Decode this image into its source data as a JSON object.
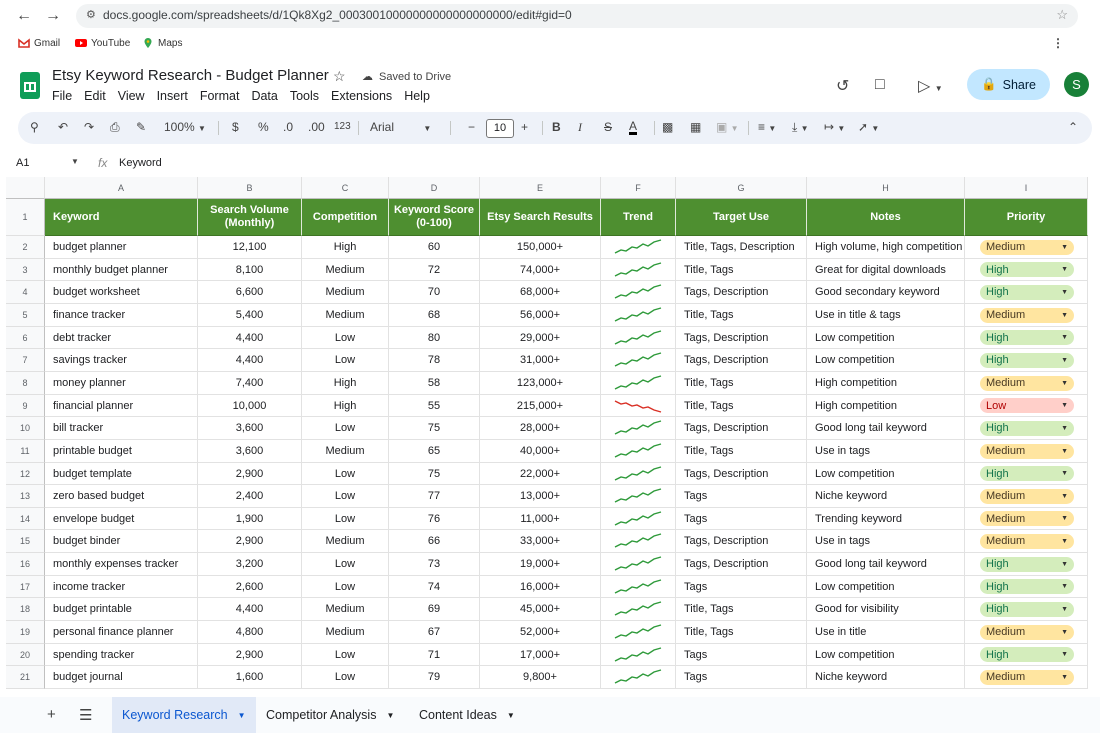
{
  "browser": {
    "url": "docs.google.com/spreadsheets/d/1Qk8Xg2_00030010000000000000000000/edit#gid=0",
    "bookmarks": [
      "Gmail",
      "YouTube",
      "Maps"
    ]
  },
  "doc": {
    "title": "Etsy Keyword Research - Budget Planner",
    "saved_status": "Saved to Drive",
    "menu": [
      "File",
      "Edit",
      "View",
      "Insert",
      "Format",
      "Data",
      "Tools",
      "Extensions",
      "Help"
    ],
    "share_label": "Share",
    "avatar_initial": "S"
  },
  "toolbar": {
    "zoom": "100%",
    "currency": "$",
    "percent": "%",
    "dec_decrease": ".0",
    "dec_increase": ".00",
    "number_format": "123",
    "font": "Arial",
    "font_size": "10",
    "bold": "B",
    "italic": "I",
    "strike": "S",
    "text_color": "A"
  },
  "formula_bar": {
    "cell_ref": "A1",
    "fx": "fx",
    "value": "Keyword"
  },
  "sheet": {
    "col_letters": [
      "A",
      "B",
      "C",
      "D",
      "E",
      "F",
      "G",
      "H",
      "I"
    ],
    "headers": [
      "Keyword",
      "Search Volume (Monthly)",
      "Competition",
      "Keyword Score (0-100)",
      "Etsy Search Results",
      "Trend",
      "Target Use",
      "Notes",
      "Priority"
    ],
    "rows": [
      {
        "n": "2",
        "keyword": "budget planner",
        "volume": "12,100",
        "competition": "High",
        "score": "60",
        "results": "150,000+",
        "trend": "up",
        "target": "Title, Tags, Description",
        "notes": "High volume, high competition",
        "priority": "Medium"
      },
      {
        "n": "3",
        "keyword": "monthly budget planner",
        "volume": "8,100",
        "competition": "Medium",
        "score": "72",
        "results": "74,000+",
        "trend": "up",
        "target": "Title, Tags",
        "notes": "Great for digital downloads",
        "priority": "High"
      },
      {
        "n": "4",
        "keyword": "budget worksheet",
        "volume": "6,600",
        "competition": "Medium",
        "score": "70",
        "results": "68,000+",
        "trend": "up",
        "target": "Tags, Description",
        "notes": "Good secondary keyword",
        "priority": "High"
      },
      {
        "n": "5",
        "keyword": "finance tracker",
        "volume": "5,400",
        "competition": "Medium",
        "score": "68",
        "results": "56,000+",
        "trend": "up",
        "target": "Title, Tags",
        "notes": "Use in title & tags",
        "priority": "Medium"
      },
      {
        "n": "6",
        "keyword": "debt tracker",
        "volume": "4,400",
        "competition": "Low",
        "score": "80",
        "results": "29,000+",
        "trend": "up",
        "target": "Tags, Description",
        "notes": "Low competition",
        "priority": "High"
      },
      {
        "n": "7",
        "keyword": "savings tracker",
        "volume": "4,400",
        "competition": "Low",
        "score": "78",
        "results": "31,000+",
        "trend": "up",
        "target": "Tags, Description",
        "notes": "Low competition",
        "priority": "High"
      },
      {
        "n": "8",
        "keyword": "money planner",
        "volume": "7,400",
        "competition": "High",
        "score": "58",
        "results": "123,000+",
        "trend": "up",
        "target": "Title, Tags",
        "notes": "High competition",
        "priority": "Medium"
      },
      {
        "n": "9",
        "keyword": "financial planner",
        "volume": "10,000",
        "competition": "High",
        "score": "55",
        "results": "215,000+",
        "trend": "down",
        "target": "Title, Tags",
        "notes": "High competition",
        "priority": "Low"
      },
      {
        "n": "10",
        "keyword": "bill tracker",
        "volume": "3,600",
        "competition": "Low",
        "score": "75",
        "results": "28,000+",
        "trend": "up",
        "target": "Tags, Description",
        "notes": "Good long tail keyword",
        "priority": "High"
      },
      {
        "n": "11",
        "keyword": "printable budget",
        "volume": "3,600",
        "competition": "Medium",
        "score": "65",
        "results": "40,000+",
        "trend": "up",
        "target": "Title, Tags",
        "notes": "Use in tags",
        "priority": "Medium"
      },
      {
        "n": "12",
        "keyword": "budget template",
        "volume": "2,900",
        "competition": "Low",
        "score": "75",
        "results": "22,000+",
        "trend": "up",
        "target": "Tags, Description",
        "notes": "Low competition",
        "priority": "High"
      },
      {
        "n": "13",
        "keyword": "zero based budget",
        "volume": "2,400",
        "competition": "Low",
        "score": "77",
        "results": "13,000+",
        "trend": "up",
        "target": "Tags",
        "notes": "Niche keyword",
        "priority": "Medium"
      },
      {
        "n": "14",
        "keyword": "envelope budget",
        "volume": "1,900",
        "competition": "Low",
        "score": "76",
        "results": "11,000+",
        "trend": "up",
        "target": "Tags",
        "notes": "Trending keyword",
        "priority": "Medium"
      },
      {
        "n": "15",
        "keyword": "budget binder",
        "volume": "2,900",
        "competition": "Medium",
        "score": "66",
        "results": "33,000+",
        "trend": "up",
        "target": "Tags, Description",
        "notes": "Use in tags",
        "priority": "Medium"
      },
      {
        "n": "16",
        "keyword": "monthly expenses tracker",
        "volume": "3,200",
        "competition": "Low",
        "score": "73",
        "results": "19,000+",
        "trend": "up",
        "target": "Tags, Description",
        "notes": "Good long tail keyword",
        "priority": "High"
      },
      {
        "n": "17",
        "keyword": "income tracker",
        "volume": "2,600",
        "competition": "Low",
        "score": "74",
        "results": "16,000+",
        "trend": "up",
        "target": "Tags",
        "notes": "Low competition",
        "priority": "High"
      },
      {
        "n": "18",
        "keyword": "budget printable",
        "volume": "4,400",
        "competition": "Medium",
        "score": "69",
        "results": "45,000+",
        "trend": "up",
        "target": "Title, Tags",
        "notes": "Good for visibility",
        "priority": "High"
      },
      {
        "n": "19",
        "keyword": "personal finance planner",
        "volume": "4,800",
        "competition": "Medium",
        "score": "67",
        "results": "52,000+",
        "trend": "up",
        "target": "Title, Tags",
        "notes": "Use in title",
        "priority": "Medium"
      },
      {
        "n": "20",
        "keyword": "spending tracker",
        "volume": "2,900",
        "competition": "Low",
        "score": "71",
        "results": "17,000+",
        "trend": "up",
        "target": "Tags",
        "notes": "Low competition",
        "priority": "High"
      },
      {
        "n": "21",
        "keyword": "budget journal",
        "volume": "1,600",
        "competition": "Low",
        "score": "79",
        "results": "9,800+",
        "trend": "up",
        "target": "Tags",
        "notes": "Niche keyword",
        "priority": "Medium"
      }
    ]
  },
  "tabs": [
    "Keyword Research",
    "Competitor Analysis",
    "Content Ideas"
  ],
  "colors": {
    "header_green": "#4e8f30",
    "trend_up": "#2e9a3a",
    "trend_down": "#d93025",
    "chip_high": "#d4edbc",
    "chip_medium": "#ffe5a0",
    "chip_low": "#ffcfc9",
    "share_bg": "#c2e7ff"
  }
}
